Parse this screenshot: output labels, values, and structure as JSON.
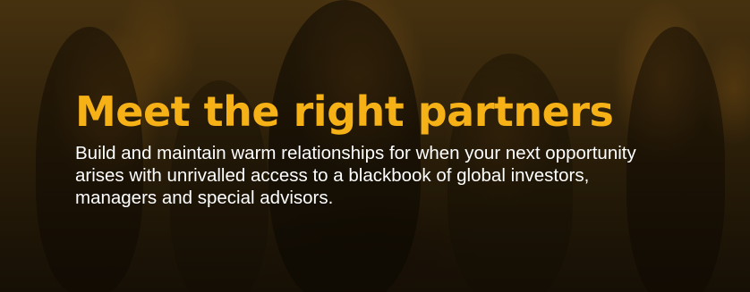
{
  "hero": {
    "headline": "Meet the right partners",
    "body": "Build and maintain warm relationships for when your next opportunity arises with unrivalled access to a blackbook of global investors, managers and special advisors."
  },
  "colors": {
    "accent": "#f5b116",
    "text": "#ffffff",
    "background_tint": "#3a290c"
  }
}
